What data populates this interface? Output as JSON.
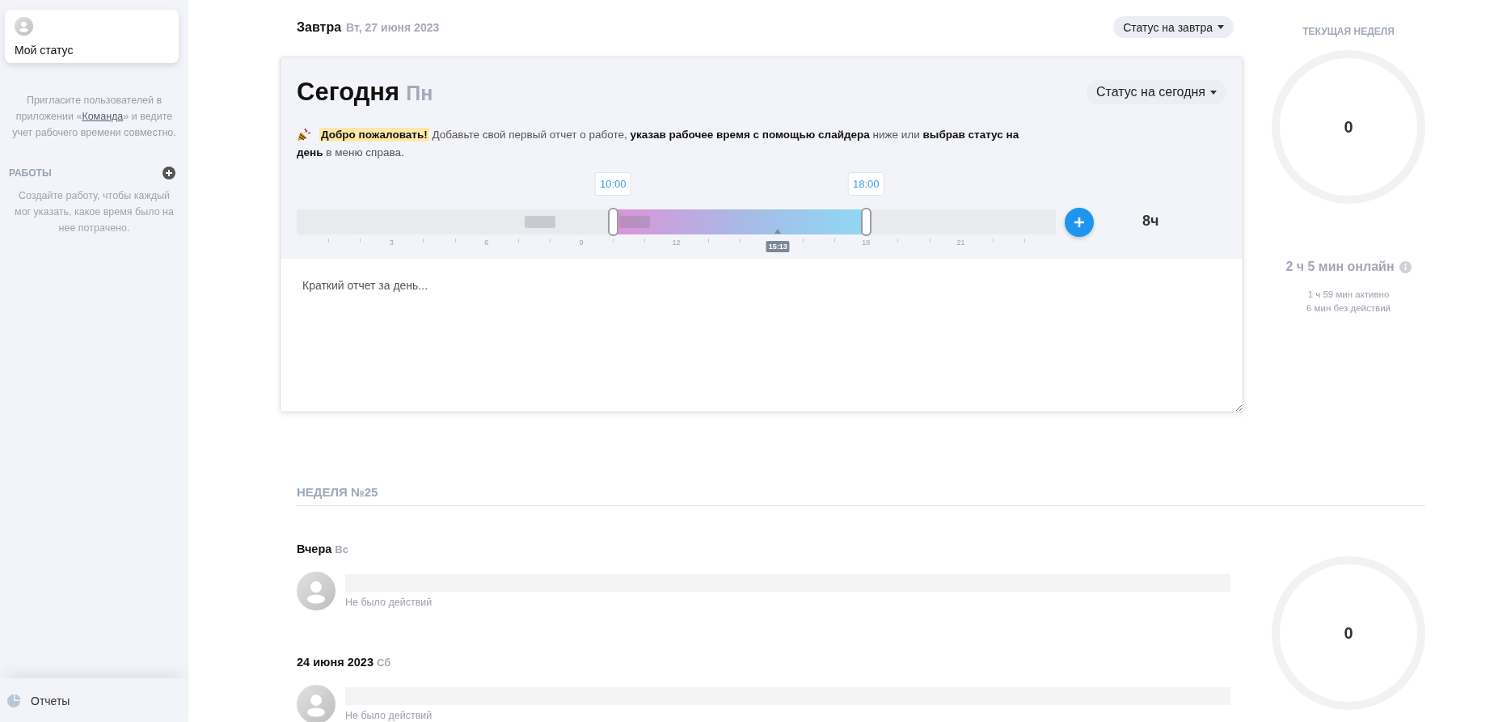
{
  "sidebar": {
    "status_card": {
      "label": "Мой статус"
    },
    "invite": {
      "before": "Пригласите пользователей в приложении «",
      "link": "Команда",
      "after": "» и ведите учет рабочего времени совместно."
    },
    "works": {
      "title": "РАБОТЫ",
      "hint": "Создайте работу, чтобы каждый мог указать, какое время было на нее потрачено."
    },
    "footer_item": {
      "label": "Отчеты"
    }
  },
  "tomorrow": {
    "title": "Завтра",
    "date": "Вт, 27 июня 2023",
    "status_button": "Статус на завтра"
  },
  "today": {
    "title": "Сегодня",
    "weekday": "Пн",
    "status_button": "Статус на сегодня",
    "message": "**Добро пожаловать!** Добавьте свой первый отчет о работе, **указав рабочее время с помощью слайдера** ниже или **выбрав статус на день** в меню справа.",
    "slider": {
      "start": {
        "label": "10:00",
        "level": 0.4167
      },
      "end": {
        "label": "18:00",
        "level": 0.75
      },
      "now": {
        "label": "15:13",
        "level": 0.634
      },
      "activity": [
        {
          "level": 0.3
        },
        {
          "level": 0.425
        }
      ],
      "tick_labels": [
        {
          "label": "3",
          "level": 0.125
        },
        {
          "label": "6",
          "level": 0.25
        },
        {
          "label": "9",
          "level": 0.375
        },
        {
          "label": "12",
          "level": 0.5
        },
        {
          "label": "18",
          "level": 0.75
        },
        {
          "label": "21",
          "level": 0.875
        }
      ]
    },
    "total": "8ч",
    "report": {
      "placeholder": "Краткий отчет за день..."
    }
  },
  "week_stats": {
    "title": "ТЕКУЩАЯ НЕДЕЛЯ",
    "count": "0",
    "online": "2 ч 5 мин онлайн",
    "active": "1 ч 59 мин активно",
    "idle": "6 мин без действий"
  },
  "week": {
    "title": "НЕДЕЛЯ №25",
    "count": "0",
    "days": [
      {
        "title": "Вчера",
        "weekday": "Вс",
        "status": "Не было действий"
      },
      {
        "title": "24 июня 2023",
        "weekday": "Сб",
        "status": "Не было действий"
      }
    ]
  }
}
